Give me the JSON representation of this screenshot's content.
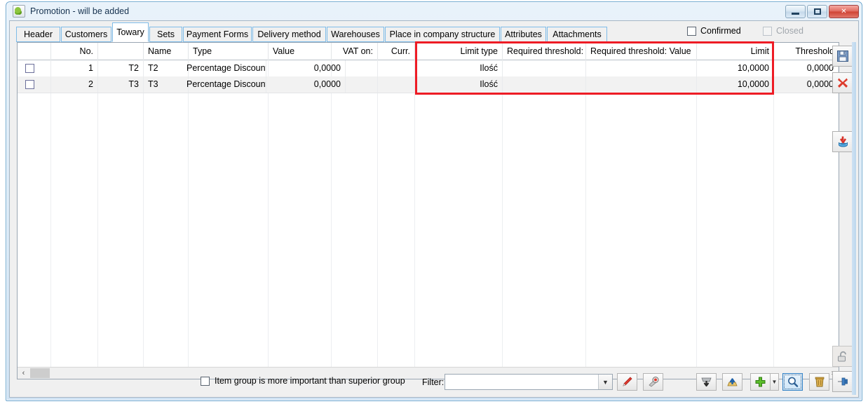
{
  "window": {
    "title": "Promotion - will be added",
    "icon": "app-icon",
    "buttons": {
      "minimize": "minimize",
      "maximize": "maximize",
      "close": "close"
    }
  },
  "tabs": [
    {
      "label": "Header",
      "active": false
    },
    {
      "label": "Customers",
      "active": false
    },
    {
      "label": "Towary",
      "active": true
    },
    {
      "label": "Sets",
      "active": false
    },
    {
      "label": "Payment Forms",
      "active": false
    },
    {
      "label": "Delivery method",
      "active": false
    },
    {
      "label": "Warehouses",
      "active": false
    },
    {
      "label": "Place in company structure",
      "active": false
    },
    {
      "label": "Attributes",
      "active": false
    },
    {
      "label": "Attachments",
      "active": false
    }
  ],
  "status_checks": {
    "confirmed_label": "Confirmed",
    "confirmed_checked": false,
    "confirmed_enabled": true,
    "closed_label": "Closed",
    "closed_checked": false,
    "closed_enabled": false
  },
  "grid": {
    "columns": [
      {
        "key": "check",
        "label": "",
        "align": "left"
      },
      {
        "key": "no",
        "label": "No.",
        "align": "right"
      },
      {
        "key": "code",
        "label": "",
        "align": "right"
      },
      {
        "key": "name",
        "label": "Name",
        "align": "left"
      },
      {
        "key": "type",
        "label": "Type",
        "align": "left"
      },
      {
        "key": "value",
        "label": "Value",
        "align": "left"
      },
      {
        "key": "vat_on",
        "label": "VAT on:",
        "align": "right"
      },
      {
        "key": "curr",
        "label": "Curr.",
        "align": "right"
      },
      {
        "key": "limit_type",
        "label": "Limit type",
        "align": "right"
      },
      {
        "key": "req_qty",
        "label": "Required threshold: Quantity",
        "align": "left"
      },
      {
        "key": "req_val",
        "label": "Required threshold: Value",
        "align": "left"
      },
      {
        "key": "limit",
        "label": "Limit",
        "align": "right"
      },
      {
        "key": "threshold",
        "label": "Threshold",
        "align": "right"
      }
    ],
    "rows": [
      {
        "check": false,
        "no": "1",
        "code": "T2",
        "name": "T2",
        "type": "Percentage Discount",
        "value": "0,0000",
        "vat_on": "",
        "curr": "",
        "limit_type": "Ilość",
        "req_qty": "",
        "req_val": "",
        "limit": "10,0000",
        "threshold": "0,0000"
      },
      {
        "check": false,
        "no": "2",
        "code": "T3",
        "name": "T3",
        "type": "Percentage Discount",
        "value": "0,0000",
        "vat_on": "",
        "curr": "",
        "limit_type": "Ilość",
        "req_qty": "",
        "req_val": "",
        "limit": "10,0000",
        "threshold": "0,0000"
      }
    ],
    "highlight_color": "#ee1c25",
    "hscroll": {
      "left_arrow": "‹",
      "right_arrow": "›"
    }
  },
  "bottom": {
    "item_group_label": "Item group is more important than superior group",
    "item_group_checked": false,
    "filter_label": "Filter:",
    "filter_value": "",
    "filter_placeholder": "",
    "buttons": {
      "clear_filter": "clear-filter",
      "filter_builder": "filter-builder",
      "import": "import",
      "export": "export",
      "add": "add",
      "add_more": "add-options",
      "search": "search",
      "delete": "delete"
    }
  },
  "rail": {
    "save": "save",
    "cancel": "cancel",
    "save_to_db": "save-to-database",
    "unlock": "unlock",
    "pin": "pin"
  }
}
